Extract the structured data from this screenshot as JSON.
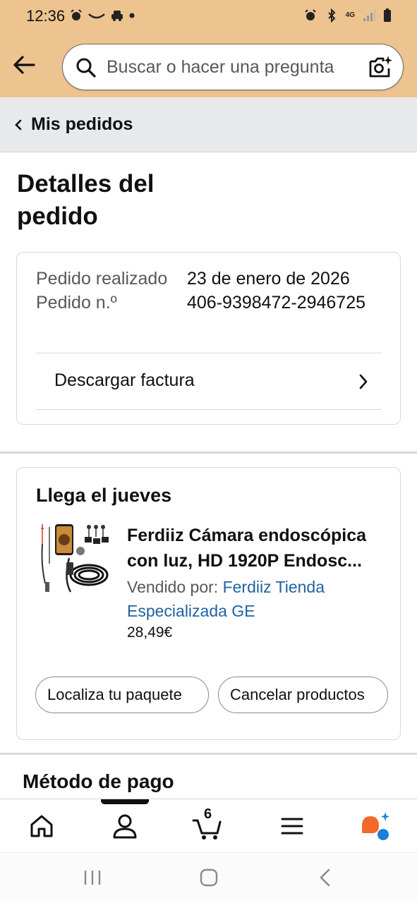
{
  "status_bar": {
    "time": "12:36",
    "network": "4G"
  },
  "header": {
    "search_placeholder": "Buscar o hacer una pregunta"
  },
  "breadcrumb": {
    "label": "Mis pedidos"
  },
  "page": {
    "title": "Detalles del pedido"
  },
  "order_info": {
    "date_label": "Pedido realizado",
    "date_value": "23 de enero de 2026",
    "number_label": "Pedido n.º",
    "number_value": "406-9398472-2946725",
    "invoice_label": "Descargar factura"
  },
  "shipment": {
    "heading": "Llega el jueves",
    "product_title": "Ferdiiz Cámara endoscópica con luz, HD 1920P Endosc...",
    "seller_prefix": "Vendido por: ",
    "seller_name": "Ferdiiz Tienda Especializada GE",
    "price": "28,49€",
    "track_button": "Localiza tu paquete",
    "cancel_button": "Cancelar productos"
  },
  "payment": {
    "heading": "Método de pago"
  },
  "bottom_nav": {
    "items": [
      "home-icon",
      "account-icon",
      "cart-icon",
      "menu-icon",
      "rufus-icon"
    ],
    "cart_count": "6",
    "active_index": 1
  },
  "colors": {
    "header_bg": "#edc38f",
    "link": "#2162a1",
    "rufus_orange": "#f3692a",
    "rufus_blue": "#1a7fd6"
  }
}
